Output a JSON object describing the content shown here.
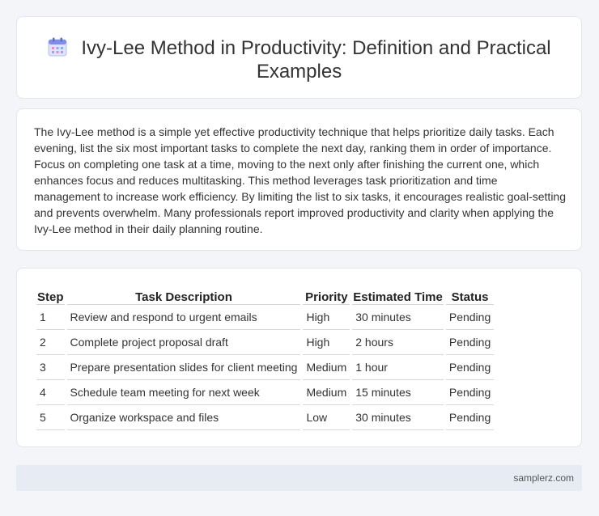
{
  "header": {
    "title": "Ivy-Lee Method in Productivity: Definition and Practical Examples",
    "icon": "calendar-icon"
  },
  "intro": {
    "text": "The Ivy-Lee method is a simple yet effective productivity technique that helps prioritize daily tasks. Each evening, list the six most important tasks to complete the next day, ranking them in order of importance. Focus on completing one task at a time, moving to the next only after finishing the current one, which enhances focus and reduces multitasking. This method leverages task prioritization and time management to increase work efficiency. By limiting the list to six tasks, it encourages realistic goal-setting and prevents overwhelm. Many professionals report improved productivity and clarity when applying the Ivy-Lee method in their daily planning routine."
  },
  "table": {
    "headers": [
      "Step",
      "Task Description",
      "Priority",
      "Estimated Time",
      "Status"
    ],
    "rows": [
      [
        "1",
        "Review and respond to urgent emails",
        "High",
        "30 minutes",
        "Pending"
      ],
      [
        "2",
        "Complete project proposal draft",
        "High",
        "2 hours",
        "Pending"
      ],
      [
        "3",
        "Prepare presentation slides for client meeting",
        "Medium",
        "1 hour",
        "Pending"
      ],
      [
        "4",
        "Schedule team meeting for next week",
        "Medium",
        "15 minutes",
        "Pending"
      ],
      [
        "5",
        "Organize workspace and files",
        "Low",
        "30 minutes",
        "Pending"
      ]
    ]
  },
  "footer": {
    "site": "samplerz.com"
  }
}
